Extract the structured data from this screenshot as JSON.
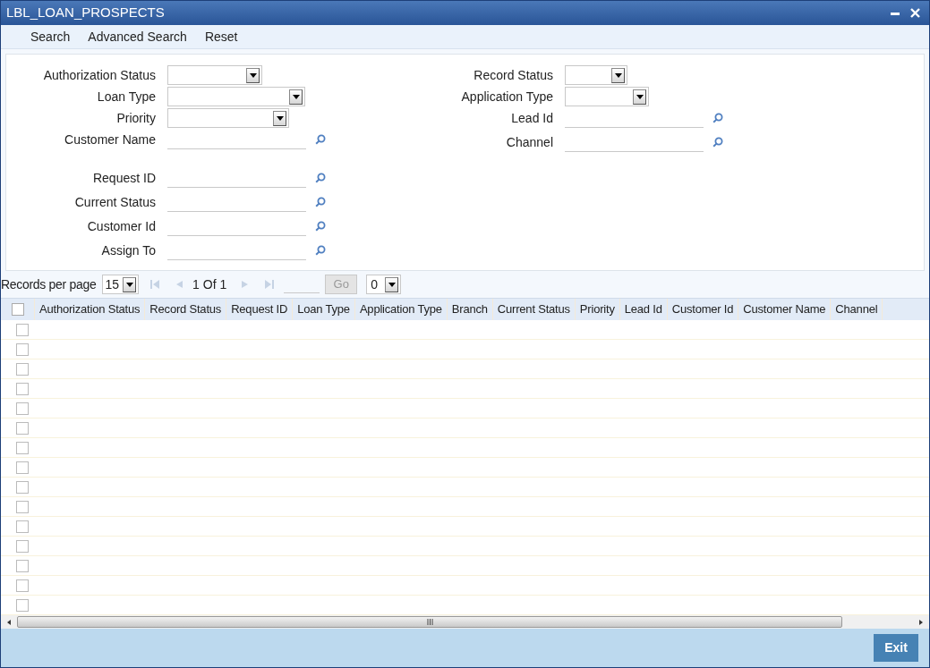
{
  "window": {
    "title": "LBL_LOAN_PROSPECTS"
  },
  "toolbar": [
    "Search",
    "Advanced Search",
    "Reset"
  ],
  "left_groups": [
    [
      {
        "label": "Authorization Status",
        "kind": "select"
      },
      {
        "label": "Loan Type",
        "kind": "select"
      },
      {
        "label": "Priority",
        "kind": "select"
      },
      {
        "label": "Customer Name",
        "kind": "lookup"
      }
    ],
    [
      {
        "label": "Request ID",
        "kind": "lookup"
      },
      {
        "label": "Current Status",
        "kind": "lookup"
      },
      {
        "label": "Customer Id",
        "kind": "lookup"
      },
      {
        "label": "Assign To",
        "kind": "lookup"
      }
    ]
  ],
  "right_fields": [
    {
      "label": "Record Status",
      "kind": "select"
    },
    {
      "label": "Application Type",
      "kind": "select"
    },
    {
      "label": "Lead Id",
      "kind": "lookup"
    },
    {
      "label": "Channel",
      "kind": "lookup"
    }
  ],
  "pagination": {
    "label": "Records per page",
    "per_page": "15",
    "page_info": "1 Of 1",
    "go": "Go",
    "page_select": "0"
  },
  "table": {
    "header_checked": false,
    "columns": [
      "Authorization Status",
      "Record Status",
      "Request ID",
      "Loan Type",
      "Application Type",
      "Branch",
      "Current Status",
      "Priority",
      "Lead Id",
      "Customer Id",
      "Customer Name",
      "Channel"
    ],
    "rows": [
      {
        "checked": false
      },
      {
        "checked": false
      },
      {
        "checked": false
      },
      {
        "checked": false
      },
      {
        "checked": false
      },
      {
        "checked": false
      },
      {
        "checked": false
      },
      {
        "checked": false
      },
      {
        "checked": false
      },
      {
        "checked": false
      },
      {
        "checked": false
      },
      {
        "checked": false
      },
      {
        "checked": false
      },
      {
        "checked": false
      },
      {
        "checked": false
      }
    ]
  },
  "footer": {
    "exit": "Exit"
  }
}
